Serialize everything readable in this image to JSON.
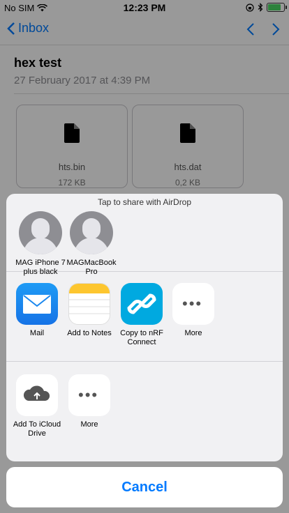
{
  "status_bar": {
    "carrier": "No SIM",
    "time": "12:23 PM"
  },
  "nav": {
    "back_label": "Inbox"
  },
  "email": {
    "subject": "hex test",
    "date": "27 February 2017 at 4:39 PM"
  },
  "attachments": [
    {
      "name": "hts.bin",
      "size": "172 KB"
    },
    {
      "name": "hts.dat",
      "size": "0,2 KB"
    }
  ],
  "share_sheet": {
    "airdrop_hint": "Tap to share with AirDrop",
    "airdrop_targets": [
      {
        "name": "MAG iPhone 7 plus black"
      },
      {
        "name": "MAGMacBookPro"
      }
    ],
    "apps": [
      {
        "label": "Mail",
        "icon": "mail-icon"
      },
      {
        "label": "Add to Notes",
        "icon": "notes-icon"
      },
      {
        "label": "Copy to nRF Connect",
        "icon": "nrf-connect-icon"
      },
      {
        "label": "More",
        "icon": "more-icon"
      }
    ],
    "actions": [
      {
        "label": "Add To iCloud Drive",
        "icon": "icloud-upload-icon"
      },
      {
        "label": "More",
        "icon": "more-icon"
      }
    ],
    "cancel_label": "Cancel"
  },
  "colors": {
    "accent": "#007aff",
    "battery": "#4cd964",
    "mail_icon": "#1a87ee",
    "nrf_icon": "#00a9e0"
  }
}
